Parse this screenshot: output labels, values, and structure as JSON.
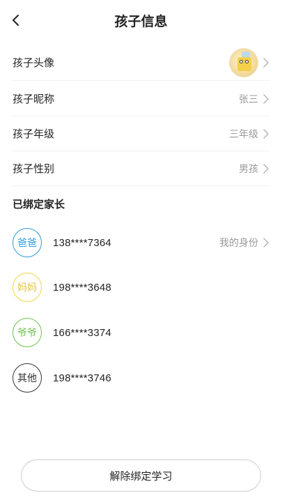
{
  "header": {
    "title": "孩子信息"
  },
  "rows": [
    {
      "label": "孩子头像",
      "value": ""
    },
    {
      "label": "孩子昵称",
      "value": "张三"
    },
    {
      "label": "孩子年级",
      "value": "三年级"
    },
    {
      "label": "孩子性别",
      "value": "男孩"
    }
  ],
  "parents": {
    "section_title": "已绑定家长",
    "items": [
      {
        "role": "爸爸",
        "phone": "138****7364",
        "tag": "我的身份",
        "color": "#2f9be0"
      },
      {
        "role": "妈妈",
        "phone": "198****3648",
        "tag": "",
        "color": "#f0d54a"
      },
      {
        "role": "爷爷",
        "phone": "166****3374",
        "tag": "",
        "color": "#6cc24a"
      },
      {
        "role": "其他",
        "phone": "198****3746",
        "tag": "",
        "color": "#333333"
      }
    ]
  },
  "footer": {
    "unbind_label": "解除绑定学习"
  },
  "icons": {
    "back": "chevron-left-icon",
    "chevron": "chevron-right-icon"
  }
}
